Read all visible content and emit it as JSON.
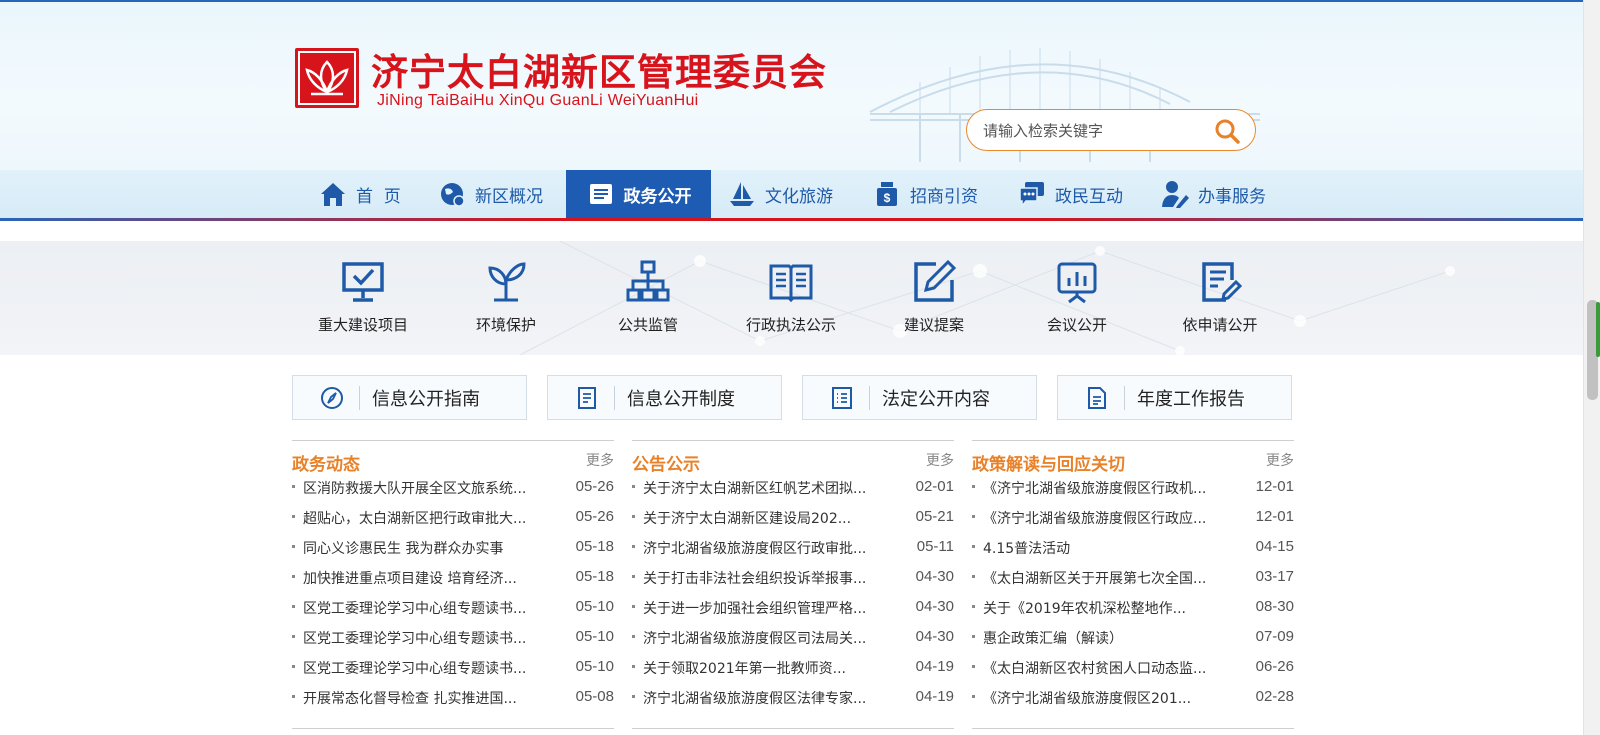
{
  "header": {
    "title": "济宁太白湖新区管理委员会",
    "subtitle": "JiNing TaiBaiHu XinQu GuanLi WeiYuanHui",
    "search_placeholder": "请输入检索关键字"
  },
  "nav": {
    "items": [
      {
        "label": "首  页",
        "icon": "home-icon"
      },
      {
        "label": "新区概况",
        "icon": "globe-icon"
      },
      {
        "label": "政务公开",
        "icon": "document-list-icon"
      },
      {
        "label": "文化旅游",
        "icon": "boat-icon"
      },
      {
        "label": "招商引资",
        "icon": "money-bag-icon"
      },
      {
        "label": "政民互动",
        "icon": "chat-icon"
      },
      {
        "label": "办事服务",
        "icon": "user-edit-icon"
      }
    ],
    "active_index": 2
  },
  "band": {
    "items": [
      {
        "label": "重大建设项目",
        "icon": "monitor-check-icon"
      },
      {
        "label": "环境保护",
        "icon": "sprout-icon"
      },
      {
        "label": "公共监管",
        "icon": "org-chart-icon"
      },
      {
        "label": "行政执法公示",
        "icon": "book-icon"
      },
      {
        "label": "建议提案",
        "icon": "edit-icon"
      },
      {
        "label": "会议公开",
        "icon": "presentation-icon"
      },
      {
        "label": "依申请公开",
        "icon": "document-edit-icon"
      }
    ]
  },
  "guides": [
    {
      "label": "信息公开指南",
      "icon": "compass-icon"
    },
    {
      "label": "信息公开制度",
      "icon": "document-icon"
    },
    {
      "label": "法定公开内容",
      "icon": "list-icon"
    },
    {
      "label": "年度工作报告",
      "icon": "file-icon"
    }
  ],
  "columns": [
    {
      "title": "政务动态",
      "more": "更多",
      "items": [
        {
          "title": "区消防救援大队开展全区文旅系统...",
          "date": "05-26"
        },
        {
          "title": "超贴心，太白湖新区把行政审批大...",
          "date": "05-26"
        },
        {
          "title": "同心义诊惠民生 我为群众办实事",
          "date": "05-18"
        },
        {
          "title": "加快推进重点项目建设 培育经济...",
          "date": "05-18"
        },
        {
          "title": "区党工委理论学习中心组专题读书...",
          "date": "05-10"
        },
        {
          "title": "区党工委理论学习中心组专题读书...",
          "date": "05-10"
        },
        {
          "title": "区党工委理论学习中心组专题读书...",
          "date": "05-10"
        },
        {
          "title": "开展常态化督导检查 扎实推进国...",
          "date": "05-08"
        }
      ]
    },
    {
      "title": "公告公示",
      "more": "更多",
      "items": [
        {
          "title": "关于济宁太白湖新区红帆艺术团拟...",
          "date": "02-01"
        },
        {
          "title": "关于济宁太白湖新区建设局202...",
          "date": "05-21"
        },
        {
          "title": "济宁北湖省级旅游度假区行政审批...",
          "date": "05-11"
        },
        {
          "title": "关于打击非法社会组织投诉举报事...",
          "date": "04-30"
        },
        {
          "title": "关于进一步加强社会组织管理严格...",
          "date": "04-30"
        },
        {
          "title": "济宁北湖省级旅游度假区司法局关...",
          "date": "04-30"
        },
        {
          "title": "关于领取2021年第一批教师资...",
          "date": "04-19"
        },
        {
          "title": "济宁北湖省级旅游度假区法律专家...",
          "date": "04-19"
        }
      ]
    },
    {
      "title": "政策解读与回应关切",
      "more": "更多",
      "items": [
        {
          "title": "《济宁北湖省级旅游度假区行政机...",
          "date": "12-01"
        },
        {
          "title": "《济宁北湖省级旅游度假区行政应...",
          "date": "12-01"
        },
        {
          "title": "4.15普法活动",
          "date": "04-15"
        },
        {
          "title": "《太白湖新区关于开展第七次全国...",
          "date": "03-17"
        },
        {
          "title": "关于《2019年农机深松整地作...",
          "date": "08-30"
        },
        {
          "title": "惠企政策汇编（解读）",
          "date": "07-09"
        },
        {
          "title": "《太白湖新区农村贫困人口动态监...",
          "date": "06-26"
        },
        {
          "title": "《济宁北湖省级旅游度假区201...",
          "date": "02-28"
        }
      ]
    }
  ],
  "colors": {
    "brand_red": "#d7141b",
    "nav_blue": "#1e5cb3",
    "accent_orange": "#e8822a"
  }
}
